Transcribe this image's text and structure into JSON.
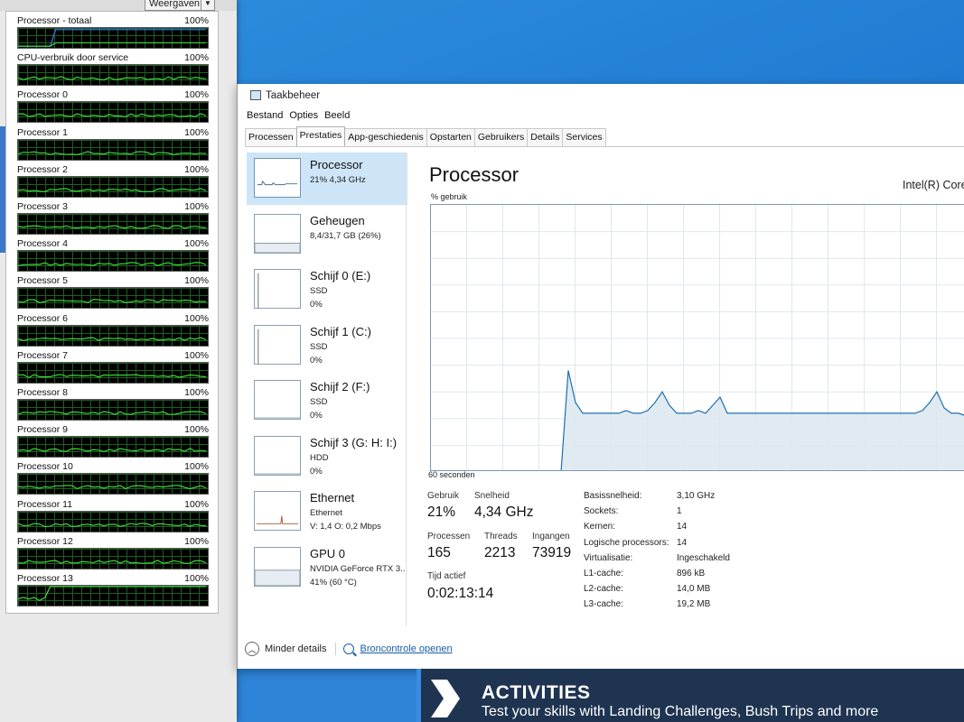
{
  "left_panel": {
    "dropdown_label": "Weergaven",
    "rows": [
      {
        "label": "Processor - totaal",
        "pct": "100%"
      },
      {
        "label": "CPU-verbruik door service",
        "pct": "100%"
      },
      {
        "label": "Processor 0",
        "pct": "100%"
      },
      {
        "label": "Processor 1",
        "pct": "100%"
      },
      {
        "label": "Processor 2",
        "pct": "100%"
      },
      {
        "label": "Processor 3",
        "pct": "100%"
      },
      {
        "label": "Processor 4",
        "pct": "100%"
      },
      {
        "label": "Processor 5",
        "pct": "100%"
      },
      {
        "label": "Processor 6",
        "pct": "100%"
      },
      {
        "label": "Processor 7",
        "pct": "100%"
      },
      {
        "label": "Processor 8",
        "pct": "100%"
      },
      {
        "label": "Processor 9",
        "pct": "100%"
      },
      {
        "label": "Processor 10",
        "pct": "100%"
      },
      {
        "label": "Processor 11",
        "pct": "100%"
      },
      {
        "label": "Processor 12",
        "pct": "100%"
      },
      {
        "label": "Processor 13",
        "pct": "100%"
      }
    ]
  },
  "taskmgr": {
    "title": "Taakbeheer",
    "menu": [
      "Bestand",
      "Opties",
      "Beeld"
    ],
    "tabs": [
      "Processen",
      "Prestaties",
      "App-geschiedenis",
      "Opstarten",
      "Gebruikers",
      "Details",
      "Services"
    ],
    "active_tab": "Prestaties",
    "sidebar": [
      {
        "title": "Processor",
        "sub": "21% 4,34 GHz",
        "sub2": "",
        "selected": true
      },
      {
        "title": "Geheugen",
        "sub": "8,4/31,7 GB (26%)",
        "sub2": "",
        "selected": false
      },
      {
        "title": "Schijf 0 (E:)",
        "sub": "SSD",
        "sub2": "0%",
        "selected": false
      },
      {
        "title": "Schijf 1 (C:)",
        "sub": "SSD",
        "sub2": "0%",
        "selected": false
      },
      {
        "title": "Schijf 2 (F:)",
        "sub": "SSD",
        "sub2": "0%",
        "selected": false
      },
      {
        "title": "Schijf 3 (G: H: I:)",
        "sub": "HDD",
        "sub2": "0%",
        "selected": false
      },
      {
        "title": "Ethernet",
        "sub": "Ethernet",
        "sub2": "V: 1,4 O: 0,2 Mbps",
        "selected": false
      },
      {
        "title": "GPU 0",
        "sub": "NVIDIA GeForce RTX 3...",
        "sub2": "41% (60 °C)",
        "selected": false
      }
    ],
    "main": {
      "title": "Processor",
      "model": "Intel(R) Core",
      "y_label": "% gebruik",
      "x_label": "60 seconden"
    },
    "stats": {
      "gebruik_label": "Gebruik",
      "gebruik": "21%",
      "snelheid_label": "Snelheid",
      "snelheid": "4,34 GHz",
      "processen_label": "Processen",
      "processen": "165",
      "threads_label": "Threads",
      "threads": "2213",
      "ingangen_label": "Ingangen",
      "ingangen": "73919",
      "tijd_label": "Tijd actief",
      "tijd": "0:02:13:14"
    },
    "specs": [
      {
        "k": "Basissnelheid:",
        "v": "3,10 GHz"
      },
      {
        "k": "Sockets:",
        "v": "1"
      },
      {
        "k": "Kernen:",
        "v": "14"
      },
      {
        "k": "Logische processors:",
        "v": "14"
      },
      {
        "k": "Virtualisatie:",
        "v": "Ingeschakeld"
      },
      {
        "k": "L1-cache:",
        "v": "896 kB"
      },
      {
        "k": "L2-cache:",
        "v": "14,0 MB"
      },
      {
        "k": "L3-cache:",
        "v": "19,2 MB"
      }
    ],
    "footer": {
      "less": "Minder details",
      "open": "Broncontrole openen"
    }
  },
  "banner": {
    "title": "ACTIVITIES",
    "subtitle": "Test your skills with Landing Challenges, Bush Trips and more"
  },
  "chart_data": {
    "type": "area",
    "y_range": [
      0,
      100
    ],
    "x_range_seconds": 60,
    "values": [
      0,
      0,
      0,
      0,
      0,
      0,
      0,
      0,
      0,
      0,
      0,
      0,
      0,
      0,
      0,
      0,
      0,
      0,
      0,
      38,
      26,
      22,
      22,
      22,
      22,
      22,
      22,
      23,
      22,
      22,
      23,
      26,
      30,
      25,
      22,
      22,
      22,
      23,
      22,
      25,
      28,
      22,
      22,
      22,
      22,
      22,
      22,
      22,
      22,
      22,
      22,
      22,
      22,
      22,
      22,
      22,
      22,
      22,
      22,
      22,
      22,
      22,
      22,
      22,
      22,
      22,
      22,
      22,
      23,
      26,
      30,
      24,
      22,
      22,
      21
    ]
  }
}
